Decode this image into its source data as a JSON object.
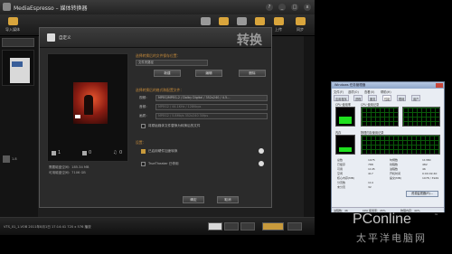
{
  "app": {
    "title": "MediaEspresso – 媒体转换器",
    "window_controls": [
      "?",
      "_",
      "□",
      "x"
    ],
    "toolbar": {
      "import_label": "导入媒体",
      "upload_label": "上传",
      "sync_label": "同步"
    },
    "left": {
      "file_label": "1.8"
    },
    "dialog": {
      "header_title": "自定义",
      "big_title": "转换",
      "save_section": "选择转换后的文件保存位置：",
      "save_path": "文件夹路径",
      "new_button": "新建",
      "edit_button": "编辑",
      "delete_button": "删除",
      "format_section": "选择转换后的格式和配置文件：",
      "video_label": "视频：",
      "video_value": "MPEG/MPEG-2 / Dolby Digital / 352x240 / 4.5…",
      "audio_label": "音频：",
      "audio_value": "MPEG2 / 44.1KHz / 128Kbps",
      "quality_label": "画质：",
      "quality_value": "MPEG2 / 5.8Mb/s 352x240 30fps",
      "overwrite_label": "将原始媒体文件替换为转换后的文件",
      "settings_section": "设置：",
      "hw_label": "已启用硬件加速转换",
      "truetheater_label": "TrueTheater 已停用",
      "required_space": "需要磁盘空间：185.34 MB",
      "available_space": "可用磁盘空间：7106 GB",
      "count_videos": "1",
      "count_images": "0",
      "count_music": "0",
      "ok_button": "确定",
      "cancel_button": "取消"
    },
    "status": {
      "text": "VTS_01_1.VOB  2011年8月1日  17:14:41  720 x 576  播放"
    }
  },
  "taskmanager": {
    "title": "Windows 任务管理器",
    "menu": [
      "文件(F)",
      "选项(O)",
      "查看(V)",
      "帮助(H)"
    ],
    "tabs": [
      "应用程序",
      "进程",
      "服务",
      "性能",
      "联网",
      "用户"
    ],
    "cpu_usage_label": "CPU 使用率",
    "cpu_history_label": "CPU 使用记录",
    "mem_label": "内存",
    "mem_history_label": "物理内存使用记录",
    "cpu_percent": 45,
    "mem_percent": 30,
    "stats_left": [
      [
        "总数",
        "1975"
      ],
      [
        "已缓存",
        "788"
      ],
      [
        "可用",
        "1145"
      ],
      [
        "空闲",
        "417"
      ],
      [
        "核心内存(MB)",
        ""
      ],
      [
        "分页数",
        "114"
      ],
      [
        "未分页",
        "32"
      ]
    ],
    "stats_right": [
      [
        "句柄数",
        "11380"
      ],
      [
        "线程数",
        "482"
      ],
      [
        "进程数",
        "46"
      ],
      [
        "开机时间",
        "0:00:49:40"
      ],
      [
        "提交(MB)",
        "1078 / 3949"
      ]
    ],
    "resource_button": "资源监视器(R)...",
    "status_processes": "进程数：46",
    "status_cpu": "CPU 使用率：45%",
    "status_mem": "物理内存：40%"
  },
  "watermark": {
    "brand": "PConline",
    "sub": "太平洋电脑网",
    "mark": "™"
  }
}
